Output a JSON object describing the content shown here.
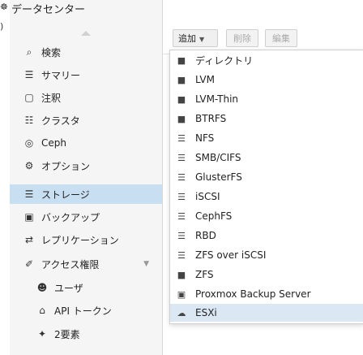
{
  "left_edge": {
    "glyph_top": "☸",
    "glyph_mid": ")"
  },
  "sidebar": {
    "header": "データセンター",
    "items": [
      {
        "label": "検索",
        "icon": "search-icon",
        "glyph": "⌕"
      },
      {
        "label": "サマリー",
        "icon": "summary-icon",
        "glyph": "☰"
      },
      {
        "label": "注釈",
        "icon": "notes-icon",
        "glyph": "▢"
      },
      {
        "label": "クラスタ",
        "icon": "cluster-icon",
        "glyph": "☷"
      },
      {
        "label": "Ceph",
        "icon": "ceph-icon",
        "glyph": "◎"
      },
      {
        "label": "オプション",
        "icon": "gear-icon",
        "glyph": "⚙"
      },
      {
        "label": "ストレージ",
        "icon": "database-icon",
        "glyph": "☰"
      },
      {
        "label": "バックアップ",
        "icon": "backup-icon",
        "glyph": "▣"
      },
      {
        "label": "レプリケーション",
        "icon": "replication-icon",
        "glyph": "⇄"
      },
      {
        "label": "アクセス権限",
        "icon": "key-icon",
        "glyph": "✐"
      },
      {
        "label": "ユーザ",
        "icon": "user-icon",
        "glyph": "☻"
      },
      {
        "label": "API トークン",
        "icon": "token-icon",
        "glyph": "⌂"
      },
      {
        "label": "2要素",
        "icon": "two-factor-icon",
        "glyph": "✦"
      }
    ]
  },
  "toolbar": {
    "add": "追加",
    "remove": "削除",
    "edit": "編集"
  },
  "add_menu": {
    "items": [
      {
        "label": "ディレクトリ",
        "icon": "folder-icon",
        "glyph": "■"
      },
      {
        "label": "LVM",
        "icon": "folder-icon",
        "glyph": "■"
      },
      {
        "label": "LVM-Thin",
        "icon": "folder-icon",
        "glyph": "■"
      },
      {
        "label": "BTRFS",
        "icon": "folder-icon",
        "glyph": "■"
      },
      {
        "label": "NFS",
        "icon": "building-icon",
        "glyph": "☰"
      },
      {
        "label": "SMB/CIFS",
        "icon": "building-icon",
        "glyph": "☰"
      },
      {
        "label": "GlusterFS",
        "icon": "building-icon",
        "glyph": "☰"
      },
      {
        "label": "iSCSI",
        "icon": "building-icon",
        "glyph": "☰"
      },
      {
        "label": "CephFS",
        "icon": "building-icon",
        "glyph": "☰"
      },
      {
        "label": "RBD",
        "icon": "building-icon",
        "glyph": "☰"
      },
      {
        "label": "ZFS over iSCSI",
        "icon": "building-icon",
        "glyph": "☰"
      },
      {
        "label": "ZFS",
        "icon": "folder-icon",
        "glyph": "■"
      },
      {
        "label": "Proxmox Backup Server",
        "icon": "floppy-icon",
        "glyph": "▣"
      },
      {
        "label": "ESXi",
        "icon": "cloud-icon",
        "glyph": "☁"
      }
    ]
  }
}
